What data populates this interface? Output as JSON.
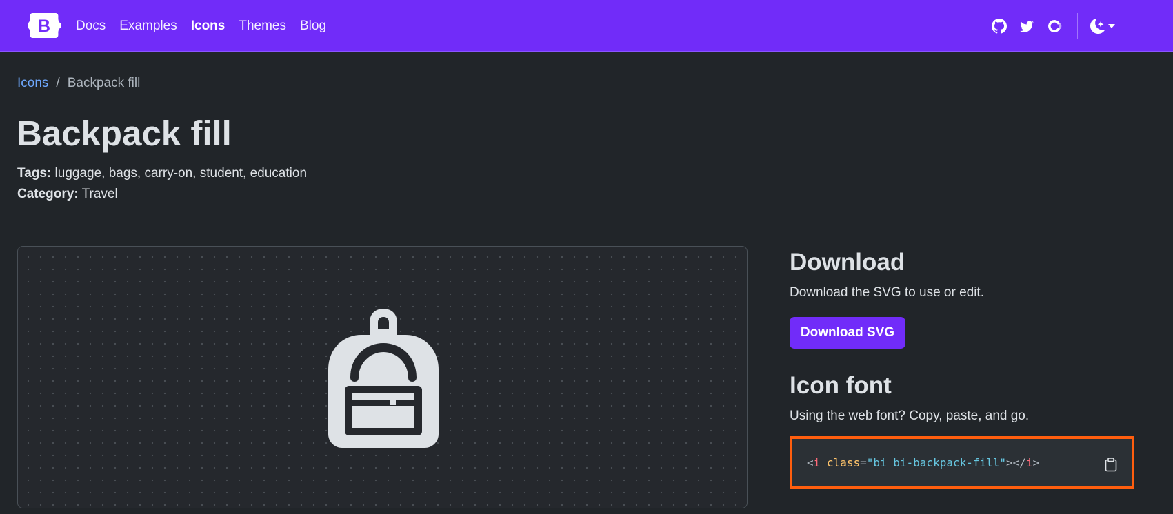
{
  "navbar": {
    "brand_letter": "B",
    "links": [
      {
        "label": "Docs",
        "active": false
      },
      {
        "label": "Examples",
        "active": false
      },
      {
        "label": "Icons",
        "active": true
      },
      {
        "label": "Themes",
        "active": false
      },
      {
        "label": "Blog",
        "active": false
      }
    ],
    "right_icons": [
      "github-icon",
      "twitter-icon",
      "opencollective-icon"
    ],
    "theme_toggle_icon": "moon-stars-icon",
    "background_color": "#712cf9"
  },
  "breadcrumb": {
    "parent_label": "Icons",
    "separator": "/",
    "current_label": "Backpack fill"
  },
  "page": {
    "title": "Backpack fill",
    "tags_label": "Tags:",
    "tags_value": "luggage, bags, carry-on, student, education",
    "category_label": "Category:",
    "category_value": "Travel"
  },
  "preview": {
    "icon": "backpack-fill-icon"
  },
  "download": {
    "heading": "Download",
    "description": "Download the SVG to use or edit.",
    "button_label": "Download SVG"
  },
  "icon_font": {
    "heading": "Icon font",
    "description": "Using the web font? Copy, paste, and go.",
    "code": {
      "open_bracket": "<",
      "tag": "i",
      "attr": "class",
      "equals": "=",
      "value": "\"bi bi-backpack-fill\"",
      "close_open": "></",
      "close_tag": "i",
      "close_bracket": ">"
    },
    "copy_icon": "clipboard-icon",
    "highlight_color": "#ff5e0e"
  }
}
